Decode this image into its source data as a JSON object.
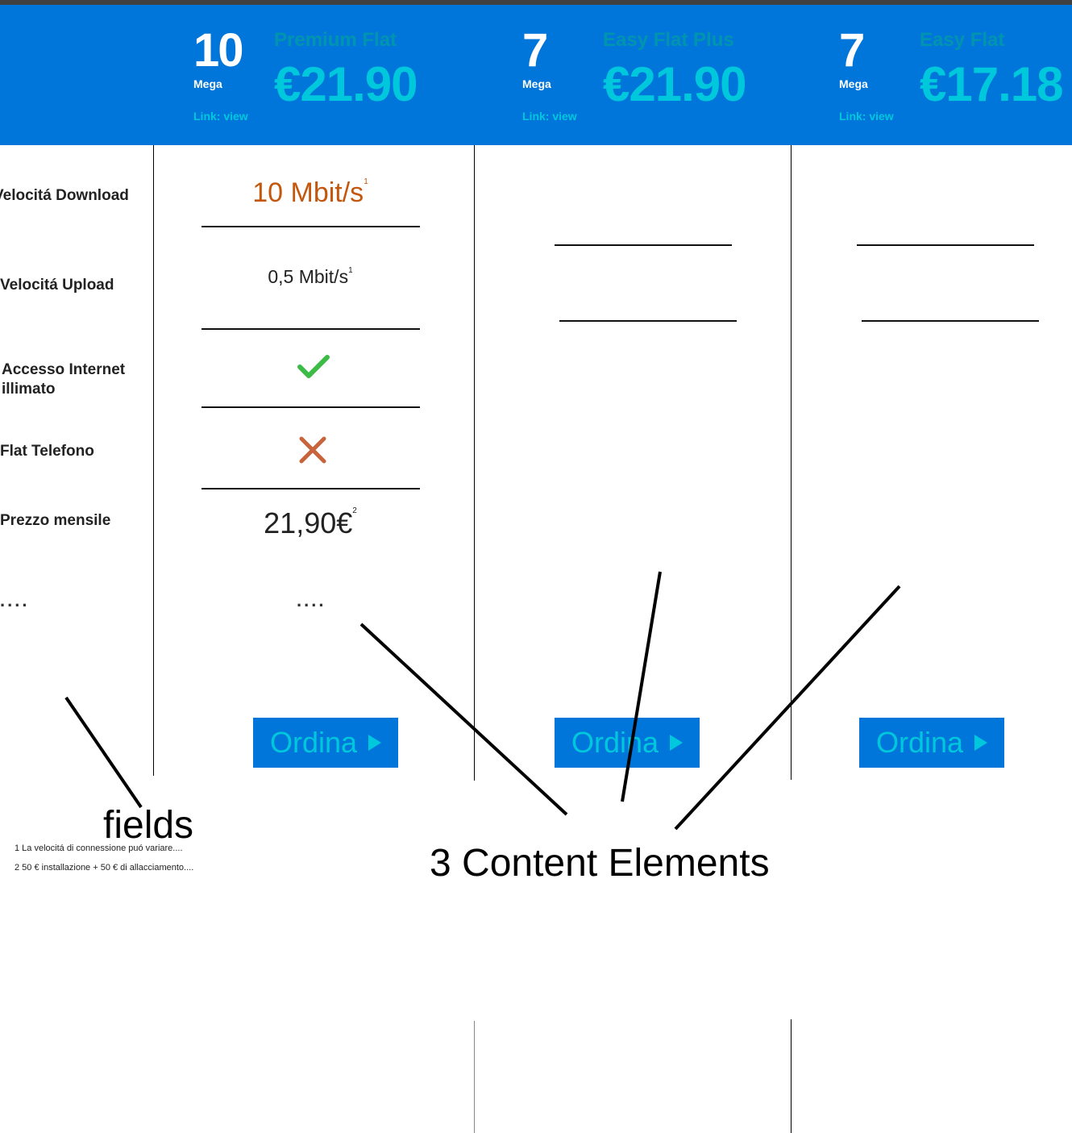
{
  "plans": [
    {
      "speed": "10",
      "unit": "Mega",
      "link": "Link: view",
      "name": "Premium Flat",
      "price": "€21.90",
      "order_label": "Ordina"
    },
    {
      "speed": "7",
      "unit": "Mega",
      "link": "Link: view",
      "name": "Easy Flat Plus",
      "price": "€21.90",
      "order_label": "Ordina"
    },
    {
      "speed": "7",
      "unit": "Mega",
      "link": "Link: view",
      "name": "Easy Flat",
      "price": "€17.18",
      "order_label": "Ordina"
    }
  ],
  "fields": [
    {
      "label": "Velocitá Download"
    },
    {
      "label": "Velocitá Upload"
    },
    {
      "label": "Accesso Internet illimato"
    },
    {
      "label": "Flat Telefono"
    },
    {
      "label": "Prezzo mensile"
    },
    {
      "label": "...."
    }
  ],
  "first_plan_values": {
    "download": "10 Mbit/s",
    "download_note": "1",
    "upload": "0,5 Mbit/s",
    "upload_note": "1",
    "internet": "check-icon",
    "phone": "cross-icon",
    "price": "21,90€",
    "price_note": "2",
    "more": "...."
  },
  "footnotes": [
    "1 La velocitá di connessione puó variare....",
    "2 50 € installazione + 50 € di allacciamento...."
  ],
  "annotations": {
    "fields_label": "fields",
    "content_label": "3 Content Elements"
  },
  "colors": {
    "header_bg": "#0075DA",
    "accent_cyan": "#00C8DC",
    "download_orange": "#C4570E",
    "check_green": "#3DBB47",
    "cross_orange": "#C8643C"
  }
}
